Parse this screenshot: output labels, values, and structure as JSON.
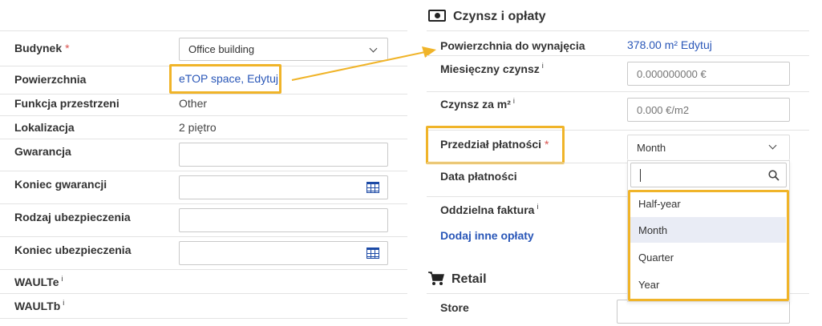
{
  "left_form": {
    "budynek": {
      "label": "Budynek",
      "required": "*",
      "value": "Office building"
    },
    "powierzchnia": {
      "label": "Powierzchnia",
      "value": "eTOP space, Edytuj"
    },
    "funkcja": {
      "label": "Funkcja przestrzeni",
      "value": "Other"
    },
    "lokalizacja": {
      "label": "Lokalizacja",
      "value": "2 piętro"
    },
    "gwarancja": {
      "label": "Gwarancja",
      "value": ""
    },
    "koniec_gwarancji": {
      "label": "Koniec gwarancji",
      "value": ""
    },
    "rodzaj_ubezpieczenia": {
      "label": "Rodzaj ubezpieczenia",
      "value": ""
    },
    "koniec_ubezpieczenia": {
      "label": "Koniec ubezpieczenia",
      "value": ""
    },
    "waulte": {
      "label": "WAULTe",
      "info": "i"
    },
    "waultb": {
      "label": "WAULTb",
      "info": "i"
    }
  },
  "czynsz_section": {
    "title": "Czynsz i opłaty",
    "icon": "money-icon",
    "powierzchnia_do_wynajecia": {
      "label": "Powierzchnia do wynajęcia",
      "value": "378.00 m² Edytuj"
    },
    "miesieczny_czynsz": {
      "label": "Miesięczny czynsz",
      "info": "i",
      "placeholder": "0.000000000 €"
    },
    "czynsz_za_m2": {
      "label": "Czynsz za m²",
      "info": "i",
      "placeholder": "0.000 €/m2"
    },
    "przedzial_platnosci": {
      "label": "Przedział płatności",
      "required": "*",
      "value": "Month"
    },
    "data_platnosci": {
      "label": "Data płatności"
    },
    "oddzielna_faktura": {
      "label": "Oddzielna faktura",
      "info": "i"
    },
    "dodaj_link": "Dodaj inne opłaty"
  },
  "dropdown": {
    "search_value": "",
    "options": [
      "Half-year",
      "Month",
      "Quarter",
      "Year"
    ],
    "hovered": "Month"
  },
  "retail_section": {
    "title": "Retail",
    "icon": "shopping-cart-icon",
    "store": {
      "label": "Store",
      "value": ""
    }
  },
  "colors": {
    "highlight": "#f0b429",
    "link": "#2a57b8",
    "divider": "#e3e3e3",
    "required": "#d9534f",
    "hovered_option": "#e9ecf5"
  }
}
